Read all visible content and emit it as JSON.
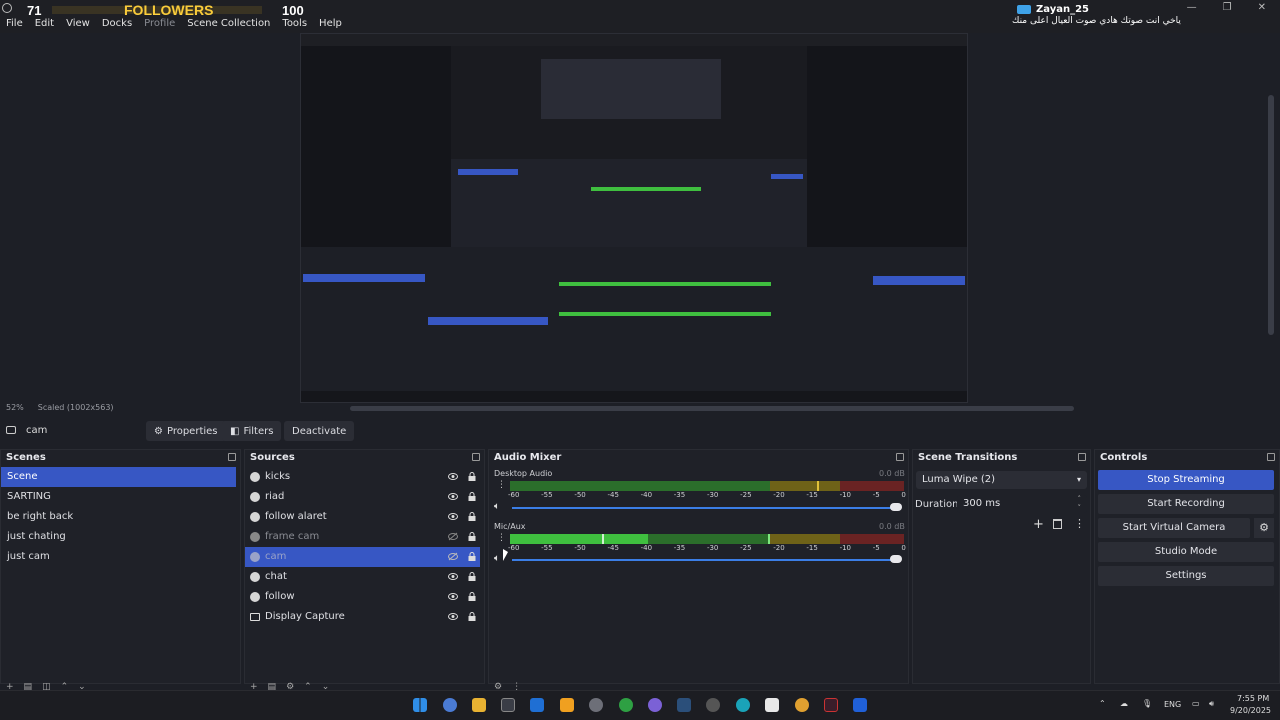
{
  "overlay": {
    "left_count": "71",
    "label": "FOLLOWERS",
    "right_count": "100"
  },
  "menu": [
    "File",
    "Edit",
    "View",
    "Docks",
    "Profile",
    "Scene Collection",
    "Tools",
    "Help"
  ],
  "chat": {
    "user": "Zayan_25",
    "message": "ياخي انت صوتك هادي صوت العيال اعلى منك"
  },
  "window_controls": [
    "—",
    "❐",
    "✕"
  ],
  "preview": {
    "zoom": "52%",
    "scale": "Scaled (1002x563)"
  },
  "context": {
    "source_name": "cam",
    "properties": "Properties",
    "filters": "Filters",
    "deactivate": "Deactivate"
  },
  "scenes": {
    "title": "Scenes",
    "items": [
      "Scene",
      "SARTING",
      "be right back",
      "just chating",
      "just cam"
    ]
  },
  "sources": {
    "title": "Sources",
    "items": [
      "kicks",
      "riad",
      "follow alaret",
      "frame cam",
      "cam",
      "chat",
      "follow",
      "Display Capture"
    ]
  },
  "mixer": {
    "title": "Audio Mixer",
    "channels": [
      {
        "name": "Desktop Audio",
        "db": "0.0 dB",
        "level": 0.0
      },
      {
        "name": "Mic/Aux",
        "db": "0.0 dB",
        "level": 0.55
      }
    ],
    "ticks": [
      "-60",
      "-55",
      "-50",
      "-45",
      "-40",
      "-35",
      "-30",
      "-25",
      "-20",
      "-15",
      "-10",
      "-5",
      "0"
    ]
  },
  "transitions": {
    "title": "Scene Transitions",
    "selected": "Luma Wipe (2)",
    "duration_label": "Duration",
    "duration_value": "300 ms"
  },
  "controls": {
    "title": "Controls",
    "buttons": [
      "Stop Streaming",
      "Start Recording",
      "Start Virtual Camera",
      "Studio Mode",
      "Settings"
    ]
  },
  "taskbar": {
    "lang": "ENG",
    "time": "7:55 PM",
    "date": "9/20/2025"
  },
  "colors": {
    "accent": "#3757c4",
    "meter_green": "#3fbf3f",
    "meter_yellow": "#b59a1f",
    "meter_red": "#a83232"
  }
}
